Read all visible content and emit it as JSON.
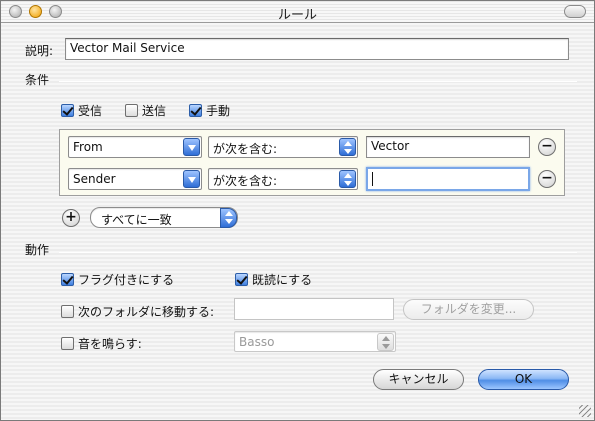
{
  "window": {
    "title": "ルール"
  },
  "description": {
    "label": "説明:",
    "value": "Vector Mail Service"
  },
  "conditions": {
    "group_label": "条件",
    "checkboxes": [
      {
        "label": "受信",
        "checked": true
      },
      {
        "label": "送信",
        "checked": false
      },
      {
        "label": "手動",
        "checked": true
      }
    ],
    "rows": [
      {
        "field": "From",
        "operator": "が次を含む:",
        "value": "Vector"
      },
      {
        "field": "Sender",
        "operator": "が次を含む:",
        "value": ""
      }
    ],
    "match_mode": "すべてに一致"
  },
  "actions": {
    "group_label": "動作",
    "flag": {
      "label": "フラグ付きにする",
      "checked": true
    },
    "mark_read": {
      "label": "既読にする",
      "checked": true
    },
    "move_to_folder": {
      "label": "次のフォルダに移動する:",
      "checked": false,
      "folder_value": "",
      "change_button": "フォルダを変更..."
    },
    "play_sound": {
      "label": "音を鳴らす:",
      "checked": false,
      "sound": "Basso"
    }
  },
  "buttons": {
    "cancel": "キャンセル",
    "ok": "OK"
  },
  "icons": {
    "add": "+",
    "remove": "−"
  },
  "colors": {
    "accent": "#3f7fe0",
    "condition_bg": "#fbfbef"
  }
}
